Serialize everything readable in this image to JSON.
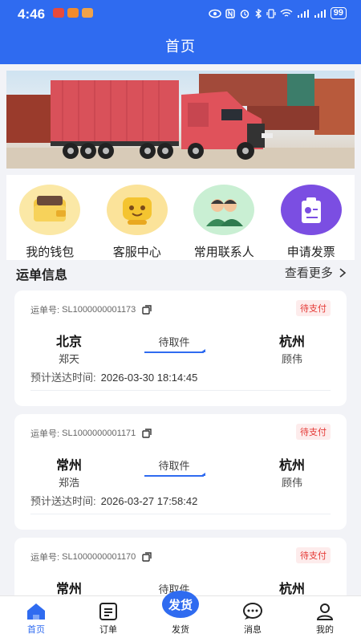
{
  "status_bar": {
    "time": "4:46",
    "battery": "99"
  },
  "header": {
    "title": "首页"
  },
  "quick_actions": [
    {
      "label": "我的钱包",
      "icon": "wallet-icon",
      "color": "#f7d85b"
    },
    {
      "label": "客服中心",
      "icon": "customer-service-icon",
      "color": "#f7d24a"
    },
    {
      "label": "常用联系人",
      "icon": "contacts-icon",
      "color": "#b9ecc4"
    },
    {
      "label": "申请发票",
      "icon": "invoice-icon",
      "color": "#7a4fe0"
    }
  ],
  "section": {
    "title": "运单信息",
    "more": "查看更多"
  },
  "orders": [
    {
      "no_label": "运单号:",
      "no": "SL1000000001173",
      "badge": "待支付",
      "from_city": "北京",
      "from_person": "郑天",
      "status": "待取件",
      "to_city": "杭州",
      "to_person": "顾伟",
      "eta_label": "预计送达时间:",
      "eta": "2026-03-30 18:14:45"
    },
    {
      "no_label": "运单号:",
      "no": "SL1000000001171",
      "badge": "待支付",
      "from_city": "常州",
      "from_person": "郑浩",
      "status": "待取件",
      "to_city": "杭州",
      "to_person": "顾伟",
      "eta_label": "预计送达时间:",
      "eta": "2026-03-27 17:58:42"
    },
    {
      "no_label": "运单号:",
      "no": "SL1000000001170",
      "badge": "待支付",
      "from_city": "常州",
      "from_person": "",
      "status": "待取件",
      "to_city": "杭州",
      "to_person": "",
      "eta_label": "",
      "eta": ""
    }
  ],
  "bottom_nav": {
    "home": "首页",
    "orders": "订单",
    "ship_fab": "发货",
    "ship": "发货",
    "messages": "消息",
    "mine": "我的"
  },
  "colors": {
    "primary": "#2f6bf0",
    "badge_red": "#e53935",
    "page_bg": "#f2f3f7"
  }
}
